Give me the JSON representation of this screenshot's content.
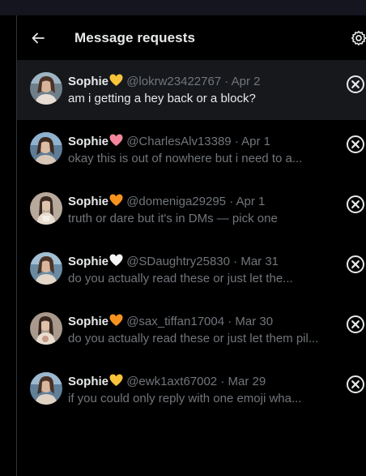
{
  "header": {
    "title": "Message requests",
    "back_icon": "arrow-left-icon",
    "settings_icon": "gear-icon"
  },
  "colors": {
    "background": "#000000",
    "active_row": "#16181c",
    "text_primary": "#e7e9ea",
    "text_secondary": "#71767b",
    "heart_yellow": "#f7c33b",
    "heart_pink": "#f4869c",
    "heart_orange": "#f6921e",
    "heart_white": "#f5f5f5"
  },
  "requests": [
    {
      "name": "Sophie",
      "heart": "yellow-heart-icon",
      "handle": "@lokrw23422767",
      "sep": "·",
      "date": "Apr 2",
      "preview": "am i getting a hey back or a block?"
    },
    {
      "name": "Sophie",
      "heart": "pink-heart-icon",
      "handle": "@CharlesAlv13389",
      "sep": "·",
      "date": "Apr 1",
      "preview": "okay this is out of nowhere but i need to a..."
    },
    {
      "name": "Sophie",
      "heart": "orange-heart-icon",
      "handle": "@domeniga29295",
      "sep": "·",
      "date": "Apr 1",
      "preview": "truth or dare but it's in DMs — pick one"
    },
    {
      "name": "Sophie",
      "heart": "white-heart-icon",
      "handle": "@SDaughtry25830",
      "sep": "·",
      "date": "Mar 31",
      "preview": "do you actually read these or just let the..."
    },
    {
      "name": "Sophie",
      "heart": "orange-heart-icon",
      "handle": "@sax_tiffan17004",
      "sep": "·",
      "date": "Mar 30",
      "preview": "do you actually read these or just let them pil..."
    },
    {
      "name": "Sophie",
      "heart": "yellow-heart-icon",
      "handle": "@ewk1axt67002",
      "sep": "·",
      "date": "Mar 29",
      "preview": "if you could only reply with one emoji wha..."
    }
  ]
}
